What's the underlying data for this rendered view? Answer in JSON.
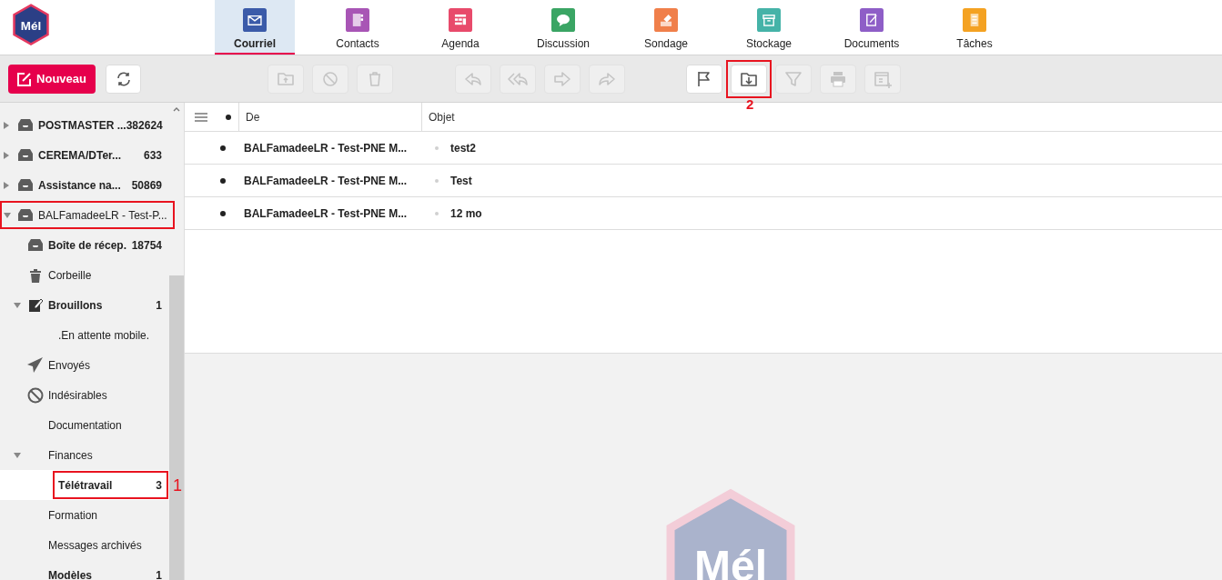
{
  "logo": {
    "text": "Mél"
  },
  "apps": [
    {
      "label": "Courriel",
      "kind": "mail",
      "color": "#3b5ba9",
      "selected": true
    },
    {
      "label": "Contacts",
      "kind": "contacts",
      "color": "#a855b5",
      "selected": false
    },
    {
      "label": "Agenda",
      "kind": "calendar",
      "color": "#e84a6b",
      "selected": false
    },
    {
      "label": "Discussion",
      "kind": "chat",
      "color": "#3aa564",
      "selected": false
    },
    {
      "label": "Sondage",
      "kind": "poll",
      "color": "#f07f4a",
      "selected": false
    },
    {
      "label": "Stockage",
      "kind": "storage",
      "color": "#45b3a8",
      "selected": false
    },
    {
      "label": "Documents",
      "kind": "documents",
      "color": "#8e5ec7",
      "selected": false
    },
    {
      "label": "Tâches",
      "kind": "tasks",
      "color": "#f4a222",
      "selected": false
    }
  ],
  "toolbar": {
    "new_button": "Nouveau",
    "groups": [
      [
        {
          "kind": "move",
          "disabled": true,
          "outlined": false
        },
        {
          "kind": "block",
          "disabled": true,
          "outlined": false
        },
        {
          "kind": "delete",
          "disabled": true,
          "outlined": false
        }
      ],
      [
        {
          "kind": "reply",
          "disabled": true,
          "outlined": false
        },
        {
          "kind": "reply-all",
          "disabled": true,
          "outlined": false
        },
        {
          "kind": "forward",
          "disabled": true,
          "outlined": false
        },
        {
          "kind": "redirect",
          "disabled": true,
          "outlined": false
        }
      ],
      [
        {
          "kind": "flag",
          "disabled": false,
          "outlined": false
        },
        {
          "kind": "import",
          "disabled": false,
          "outlined": true,
          "callout": "2"
        },
        {
          "kind": "filter",
          "disabled": true,
          "outlined": false
        },
        {
          "kind": "print",
          "disabled": true,
          "outlined": false
        },
        {
          "kind": "calendar-add",
          "disabled": true,
          "outlined": false
        }
      ]
    ]
  },
  "folders": [
    {
      "label": "POSTMASTER ...",
      "count": "382624",
      "kind": "mailbox",
      "bold": true,
      "expanded": false,
      "selected": false,
      "outlined": false
    },
    {
      "label": "CEREMA/DTer...",
      "count": "633",
      "kind": "mailbox",
      "bold": true,
      "expanded": false,
      "selected": false,
      "outlined": false
    },
    {
      "label": "Assistance na...",
      "count": "50869",
      "kind": "mailbox",
      "bold": true,
      "expanded": false,
      "selected": false,
      "outlined": false
    },
    {
      "label": "BALFamadeeLR - Test-P...",
      "kind": "mailbox",
      "bold": false,
      "expanded": true,
      "selected": false,
      "outlined": true,
      "children": [
        {
          "label": "Boîte de récep.",
          "count": "18754",
          "kind": "mailbox",
          "bold": true,
          "selected": false,
          "outlined": false
        },
        {
          "label": "Corbeille",
          "kind": "trash",
          "bold": false,
          "selected": false,
          "outlined": false
        },
        {
          "label": "Brouillons",
          "count": "1",
          "kind": "draft",
          "bold": true,
          "expanded": true,
          "selected": false,
          "outlined": false,
          "children": [
            {
              "label": ".En attente mobile.",
              "bold": false,
              "selected": false,
              "outlined": false
            }
          ]
        },
        {
          "label": "Envoyés",
          "kind": "sent",
          "bold": false,
          "selected": false,
          "outlined": false
        },
        {
          "label": "Indésirables",
          "kind": "spam",
          "bold": false,
          "selected": false,
          "outlined": false
        },
        {
          "label": "Documentation",
          "bold": false,
          "selected": false,
          "outlined": false
        },
        {
          "label": "Finances",
          "bold": false,
          "expanded": true,
          "selected": false,
          "outlined": false,
          "children": [
            {
              "label": "Télétravail",
              "count": "3",
              "bold": true,
              "selected": true,
              "outlined": true,
              "callout": "1"
            }
          ]
        },
        {
          "label": "Formation",
          "bold": false,
          "selected": false,
          "outlined": false
        },
        {
          "label": "Messages archivés",
          "bold": false,
          "selected": false,
          "outlined": false
        },
        {
          "label": "Modèles",
          "count": "1",
          "bold": true,
          "selected": false,
          "outlined": false
        }
      ]
    }
  ],
  "table": {
    "columns": [
      "De",
      "Objet"
    ],
    "rows": [
      {
        "from": "BALFamadeeLR - Test-PNE M...",
        "subject": "test2",
        "unread": true
      },
      {
        "from": "BALFamadeeLR - Test-PNE M...",
        "subject": "Test",
        "unread": true
      },
      {
        "from": "BALFamadeeLR - Test-PNE M...",
        "subject": "12 mo",
        "unread": true
      }
    ]
  },
  "preview": {
    "logo_text": "Mél"
  }
}
